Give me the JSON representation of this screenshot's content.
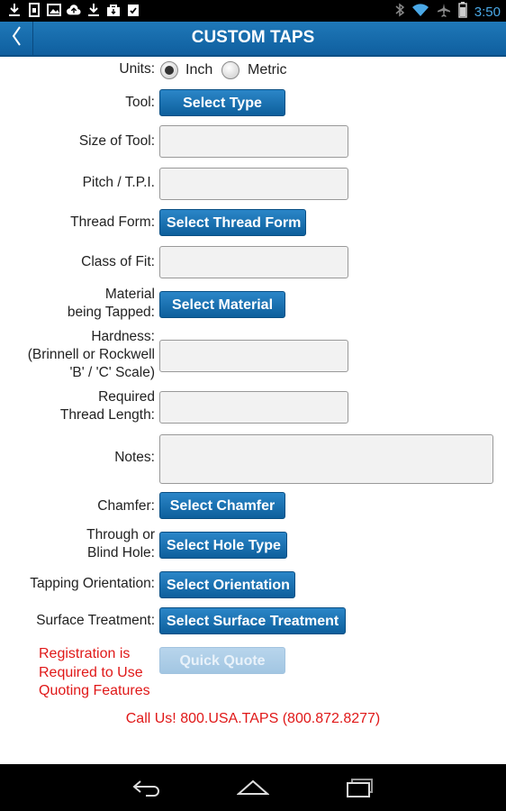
{
  "status_bar": {
    "left_icons": [
      "download-icon",
      "sim-icon",
      "image-icon",
      "cloud-upload-icon",
      "download-icon",
      "bag-icon",
      "clipboard-check-icon"
    ],
    "right_icons": [
      "bluetooth-icon",
      "wifi-icon",
      "airplane-icon",
      "battery-icon"
    ],
    "time": "3:50"
  },
  "app_bar": {
    "title": "CUSTOM TAPS",
    "back_icon": "chevron-left-icon"
  },
  "form": {
    "units": {
      "label": "Units:",
      "options": [
        "Inch",
        "Metric"
      ],
      "selected": "Inch"
    },
    "tool": {
      "label": "Tool:",
      "button": "Select Type"
    },
    "size": {
      "label": "Size of Tool:",
      "value": ""
    },
    "pitch": {
      "label": "Pitch / T.P.I.",
      "value": ""
    },
    "thread_form": {
      "label": "Thread Form:",
      "button": "Select Thread Form"
    },
    "class_fit": {
      "label": "Class of Fit:",
      "value": ""
    },
    "material": {
      "label_line1": "Material",
      "label_line2": "being Tapped:",
      "button": "Select Material"
    },
    "hardness": {
      "label_line1": "Hardness:",
      "label_line2": "(Brinnell or Rockwell",
      "label_line3": "'B' / 'C' Scale)",
      "value": ""
    },
    "thread_length": {
      "label_line1": "Required",
      "label_line2": "Thread Length:",
      "value": ""
    },
    "notes": {
      "label": "Notes:",
      "value": ""
    },
    "chamfer": {
      "label": "Chamfer:",
      "button": "Select Chamfer"
    },
    "hole": {
      "label_line1": "Through or",
      "label_line2": "Blind Hole:",
      "button": "Select Hole Type"
    },
    "orientation": {
      "label": "Tapping Orientation:",
      "button": "Select Orientation"
    },
    "surface": {
      "label": "Surface Treatment:",
      "button": "Select Surface Treatment"
    },
    "registration": {
      "line1": "Registration is",
      "line2": "Required to Use",
      "line3": "Quoting Features"
    },
    "quick_quote": "Quick Quote",
    "call": "Call Us!  800.USA.TAPS  (800.872.8277)"
  },
  "colors": {
    "accent": "#1a70b0",
    "warning": "#e01818",
    "clock": "#4aa8e6"
  },
  "nav_bar": [
    "back-arrow-icon",
    "home-icon",
    "recent-apps-icon"
  ]
}
